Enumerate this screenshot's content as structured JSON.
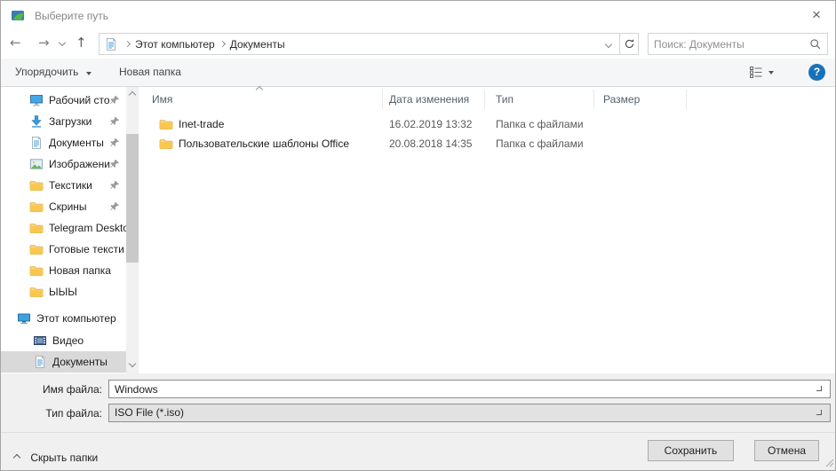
{
  "window": {
    "title": "Выберите путь",
    "close_glyph": "×"
  },
  "navbar": {
    "breadcrumb": [
      "Этот компьютер",
      "Документы"
    ],
    "search_placeholder": "Поиск: Документы"
  },
  "toolbar": {
    "organize_label": "Упорядочить",
    "new_folder_label": "Новая папка",
    "help_glyph": "?"
  },
  "sidebar": {
    "quick_access": [
      {
        "label": "Рабочий сто",
        "icon": "desktop-icon",
        "pinned": true
      },
      {
        "label": "Загрузки",
        "icon": "downloads-icon",
        "pinned": true
      },
      {
        "label": "Документы",
        "icon": "document-icon",
        "pinned": true
      },
      {
        "label": "Изображени",
        "icon": "pictures-icon",
        "pinned": true
      },
      {
        "label": "Текстики",
        "icon": "folder-icon",
        "pinned": true
      },
      {
        "label": "Скрины",
        "icon": "folder-icon",
        "pinned": true
      },
      {
        "label": "Telegram Deskto",
        "icon": "folder-icon",
        "pinned": false
      },
      {
        "label": "Готовые тексти",
        "icon": "folder-icon",
        "pinned": false
      },
      {
        "label": "Новая папка",
        "icon": "folder-icon",
        "pinned": false
      },
      {
        "label": "ЫЫЫ",
        "icon": "folder-icon",
        "pinned": false
      }
    ],
    "this_pc": {
      "label": "Этот компьютер",
      "icon": "computer-icon"
    },
    "this_pc_children": [
      {
        "label": "Видео",
        "icon": "videos-icon",
        "selected": false
      },
      {
        "label": "Документы",
        "icon": "document-icon",
        "selected": true
      }
    ]
  },
  "file_list": {
    "columns": [
      "Имя",
      "Дата изменения",
      "Тип",
      "Размер"
    ],
    "rows": [
      {
        "name": "Inet-trade",
        "date": "16.02.2019 13:32",
        "type": "Папка с файлами",
        "size": ""
      },
      {
        "name": "Пользовательские шаблоны Office",
        "date": "20.08.2018 14:35",
        "type": "Папка с файлами",
        "size": ""
      }
    ]
  },
  "footer": {
    "filename_label": "Имя файла:",
    "filename_value": "Windows",
    "filetype_label": "Тип файла:",
    "filetype_value": "ISO File (*.iso)",
    "hide_folders_label": "Скрыть папки",
    "save_label": "Сохранить",
    "cancel_label": "Отмена"
  },
  "colors": {
    "accent_blue": "#1872bb",
    "folder_yellow": "#fcd575",
    "selection_gray": "#d9d9d9",
    "toolbar_bg": "#f5f6f7"
  }
}
